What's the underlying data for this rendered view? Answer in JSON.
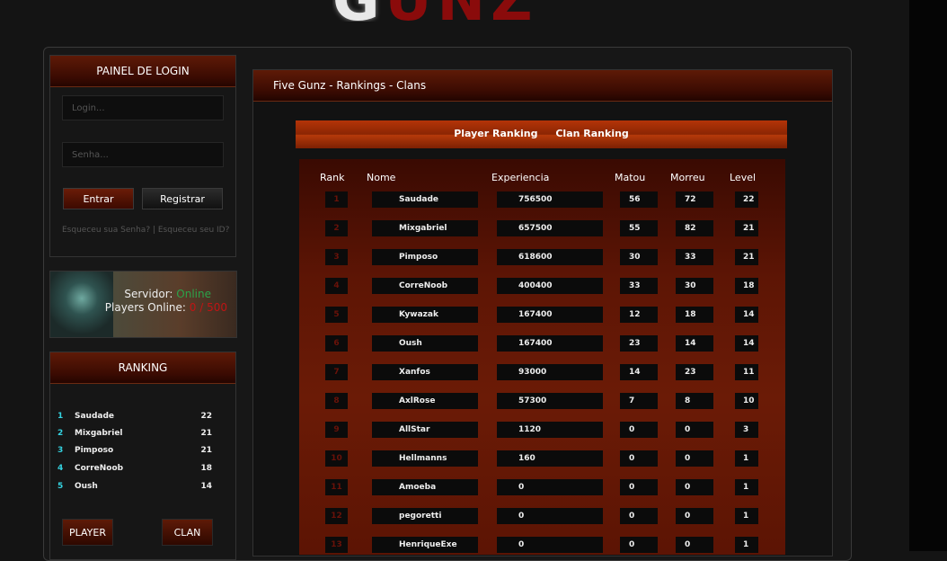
{
  "logo": {
    "first": "G",
    "rest": "UNZ"
  },
  "login": {
    "title": "PAINEL DE LOGIN",
    "login_placeholder": "Login...",
    "password_placeholder": "Senha...",
    "enter_label": "Entrar",
    "register_label": "Registrar",
    "forgot_text": "Esqueceu sua Senha? | Esqueceu seu ID?"
  },
  "server": {
    "server_label": "Servidor:",
    "server_status": "Online",
    "players_label": "Players Online:",
    "players_count": "0 / 500"
  },
  "side_ranking": {
    "title": "RANKING",
    "items": [
      {
        "pos": "1",
        "name": "Saudade",
        "level": "22"
      },
      {
        "pos": "2",
        "name": "Mixgabriel",
        "level": "21"
      },
      {
        "pos": "3",
        "name": "Pimposo",
        "level": "21"
      },
      {
        "pos": "4",
        "name": "CorreNoob",
        "level": "18"
      },
      {
        "pos": "5",
        "name": "Oush",
        "level": "14"
      }
    ],
    "player_btn": "PLAYER",
    "clan_btn": "CLAN"
  },
  "main": {
    "breadcrumb": "Five Gunz - Rankings - Clans",
    "tabs": [
      "Player Ranking",
      "Clan Ranking"
    ],
    "columns": [
      "Rank",
      "Nome",
      "Experiencia",
      "Matou",
      "Morreu",
      "Level"
    ],
    "rows": [
      [
        "1",
        "Saudade",
        "756500",
        "56",
        "72",
        "22"
      ],
      [
        "2",
        "Mixgabriel",
        "657500",
        "55",
        "82",
        "21"
      ],
      [
        "3",
        "Pimposo",
        "618600",
        "30",
        "33",
        "21"
      ],
      [
        "4",
        "CorreNoob",
        "400400",
        "33",
        "30",
        "18"
      ],
      [
        "5",
        "Kywazak",
        "167400",
        "12",
        "18",
        "14"
      ],
      [
        "6",
        "Oush",
        "167400",
        "23",
        "14",
        "14"
      ],
      [
        "7",
        "Xanfos",
        "93000",
        "14",
        "23",
        "11"
      ],
      [
        "8",
        "AxlRose",
        "57300",
        "7",
        "8",
        "10"
      ],
      [
        "9",
        "AllStar",
        "1120",
        "0",
        "0",
        "3"
      ],
      [
        "10",
        "Hellmanns",
        "160",
        "0",
        "0",
        "1"
      ],
      [
        "11",
        "Amoeba",
        "0",
        "0",
        "0",
        "1"
      ],
      [
        "12",
        "pegoretti",
        "0",
        "0",
        "0",
        "1"
      ],
      [
        "13",
        "HenriqueExe",
        "0",
        "0",
        "0",
        "1"
      ]
    ]
  }
}
